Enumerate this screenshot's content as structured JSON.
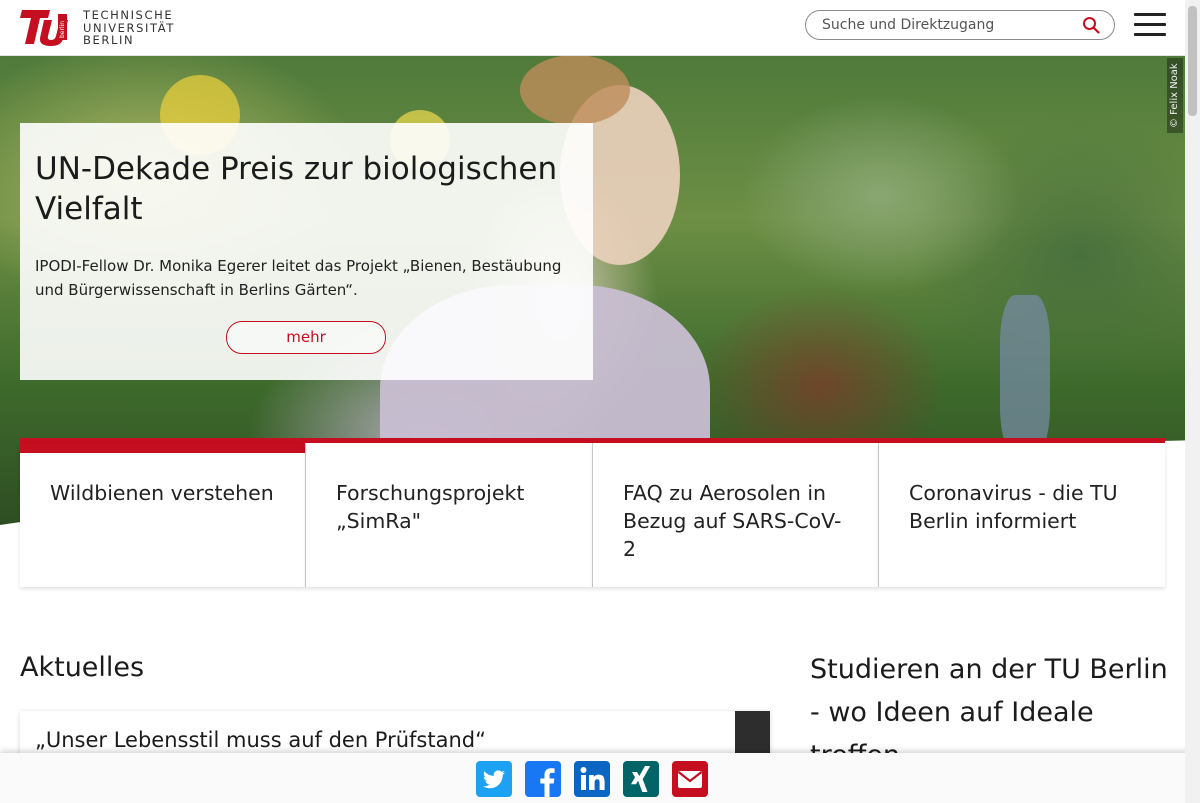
{
  "header": {
    "logo_lines": [
      "TECHNISCHE",
      "UNIVERSITÄT",
      "BERLIN"
    ],
    "logo_badge": "berlin",
    "search_placeholder": "Suche und Direktzugang"
  },
  "hero": {
    "photo_credit": "© Felix Noak",
    "title": "UN-Dekade Preis zur biologischen Vielfalt",
    "text": "IPODI-Fellow Dr. Monika Egerer leitet das Projekt „Bienen, Bestäubung und Bürgerwissenschaft in Berlins Gärten“.",
    "button_label": "mehr"
  },
  "cards": [
    {
      "title": "Wildbienen verstehen",
      "active": true
    },
    {
      "title": "Forschungsprojekt „SimRa\"",
      "active": false
    },
    {
      "title": "FAQ zu Aerosolen in Bezug auf SARS-CoV-2",
      "active": false
    },
    {
      "title": "Coronavirus - die TU Berlin informiert",
      "active": false
    }
  ],
  "news": {
    "section_title": "Aktuelles",
    "item_title": "„Unser Lebensstil muss auf den Prüfstand“"
  },
  "study": {
    "title": "Studieren an der TU Berlin - wo Ideen auf Ideale treffen"
  },
  "share": {
    "icons": [
      "twitter-icon",
      "facebook-icon",
      "linkedin-icon",
      "xing-icon",
      "email-icon"
    ]
  },
  "colors": {
    "accent": "#c50e1f",
    "twitter": "#1da1f2",
    "facebook": "#1877f2",
    "linkedin": "#0a66c2",
    "xing": "#026466",
    "email": "#c50e1f"
  }
}
